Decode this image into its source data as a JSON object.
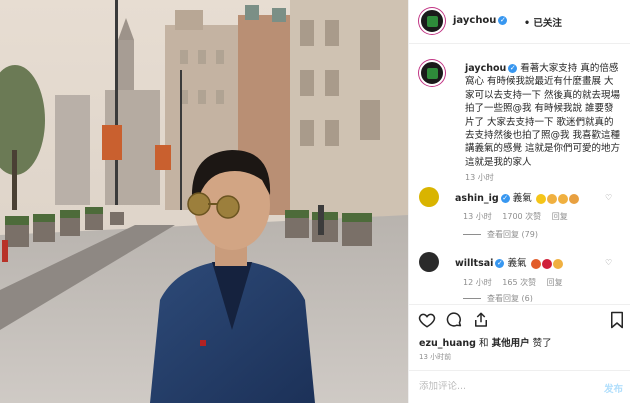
{
  "header": {
    "username": "jaychou",
    "separator": "•",
    "follow_status": "已关注"
  },
  "caption": {
    "username": "jaychou",
    "text": "看著大家支持 真的倍感窩心 有時候我說最近有什麼畫展 大家可以去支持一下 然後真的就去現場拍了一些照@我 有時候我說 誰要發片了 大家去支持一下 歌迷們就真的去支持然後也拍了照@我 我喜歡這種講義氣的感覺 這就是你們可愛的地方 這就是我的家人",
    "time": "13 小时"
  },
  "comments": [
    {
      "username": "ashin_ig",
      "text": "義氣",
      "time": "13 小时",
      "likes": "1700 次赞",
      "reply": "回复",
      "view_replies": "查看回复 (79)"
    },
    {
      "username": "willtsai",
      "text": "義氣",
      "time": "12 小时",
      "likes": "165 次赞",
      "reply": "回复",
      "view_replies": "查看回复 (6)"
    }
  ],
  "likes_line": {
    "user": "ezu_huang",
    "conj": "和",
    "others": "其他用户",
    "suffix": "赞了"
  },
  "post_time": "13 小时前",
  "add_comment": {
    "placeholder": "添加评论...",
    "post_label": "发布"
  },
  "icons": [
    "heart-icon",
    "comment-icon",
    "share-icon",
    "bookmark-icon",
    "verified-icon"
  ],
  "colors": {
    "verified": "#3897f0",
    "post_button": "#b2dffc",
    "muted": "#8e8e8e",
    "story_ring": "#c13584"
  }
}
